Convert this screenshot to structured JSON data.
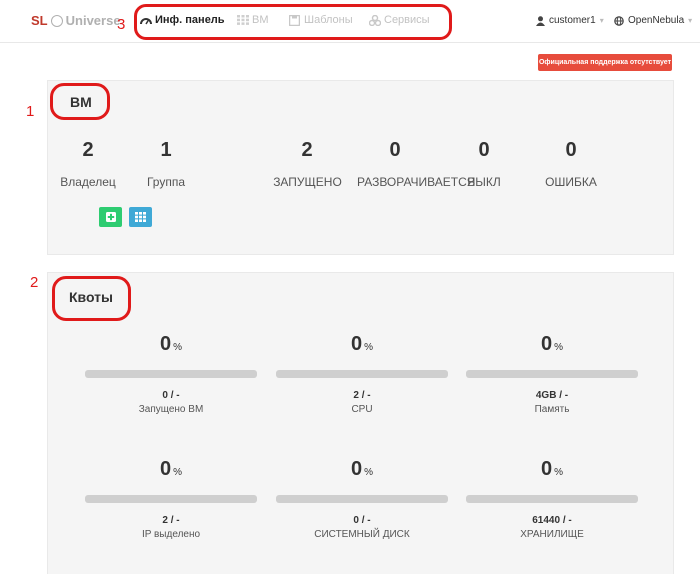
{
  "header": {
    "logo_sl": "SL",
    "logo_universe": "Universe",
    "nav": [
      {
        "label": "Инф. панель",
        "icon": "dashboard-icon"
      },
      {
        "label": "ВМ",
        "icon": "grid-icon"
      },
      {
        "label": "Шаблоны",
        "icon": "save-icon"
      },
      {
        "label": "Сервисы",
        "icon": "services-icon"
      }
    ],
    "user": "customer1",
    "zone": "OpenNebula"
  },
  "support_badge": "Официальная поддержка отсутствует",
  "annotations": {
    "one": "1",
    "two": "2",
    "three": "3"
  },
  "vm_panel": {
    "title": "ВМ",
    "stats": [
      {
        "value": "2",
        "label": "Владелец"
      },
      {
        "value": "1",
        "label": "Группа"
      },
      {
        "value": "2",
        "label": "ЗАПУЩЕНО"
      },
      {
        "value": "0",
        "label": "РАЗВОРАЧИВАЕТСЯ"
      },
      {
        "value": "0",
        "label": "ВЫКЛ"
      },
      {
        "value": "0",
        "label": "ОШИБКА"
      }
    ],
    "add_button_color": "#2ecc71",
    "list_button_color": "#3fa9d6"
  },
  "quota_panel": {
    "title": "Квоты",
    "quotas": [
      {
        "percent": "0",
        "unit": "%",
        "used": "0 / -",
        "name": "Запущено ВМ",
        "fill": 0
      },
      {
        "percent": "0",
        "unit": "%",
        "used": "2 / -",
        "name": "CPU",
        "fill": 0
      },
      {
        "percent": "0",
        "unit": "%",
        "used": "4GB / -",
        "name": "Память",
        "fill": 0
      },
      {
        "percent": "0",
        "unit": "%",
        "used": "2 / -",
        "name": "IP выделено",
        "fill": 0
      },
      {
        "percent": "0",
        "unit": "%",
        "used": "0 / -",
        "name": "СИСТЕМНЫЙ ДИСК",
        "fill": 0
      },
      {
        "percent": "0",
        "unit": "%",
        "used": "61440 / -",
        "name": "ХРАНИЛИЩЕ",
        "fill": 0
      }
    ]
  },
  "colors": {
    "accent_red": "#e74c3c",
    "annotation_red": "#e01a1a"
  }
}
